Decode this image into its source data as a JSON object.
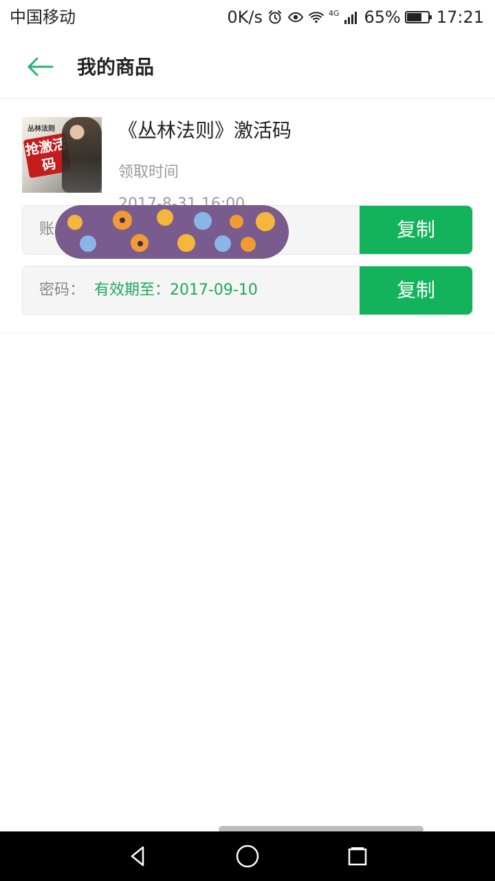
{
  "status": {
    "carrier": "中国移动",
    "net_speed": "0K/s",
    "signal_label": "4G",
    "battery": "65%",
    "time": "17:21"
  },
  "header": {
    "title": "我的商品"
  },
  "product": {
    "title": "《丛林法则》激活码",
    "claim_label": "领取时间",
    "claim_time": "2017-8-31 16:00",
    "thumb_logo_text": "丛林法则",
    "thumb_badge_text": "抢激活码",
    "account": {
      "label": "账号",
      "copy_label": "复制"
    },
    "password": {
      "label": "密码：",
      "value": "有效期至：2017-09-10",
      "copy_label": "复制"
    }
  },
  "colors": {
    "accent": "#12b35a",
    "text_secondary": "#9a9a9a",
    "valid_text": "#1aa95a",
    "redaction": "#7a5b8d"
  },
  "icons": {
    "back": "arrow-left-icon",
    "alarm": "alarm-icon",
    "eye": "eye-icon",
    "wifi": "wifi-icon",
    "signal": "signal-icon",
    "battery": "battery-icon",
    "nav_back": "nav-back-icon",
    "nav_home": "nav-home-icon",
    "nav_recent": "nav-recent-icon"
  }
}
